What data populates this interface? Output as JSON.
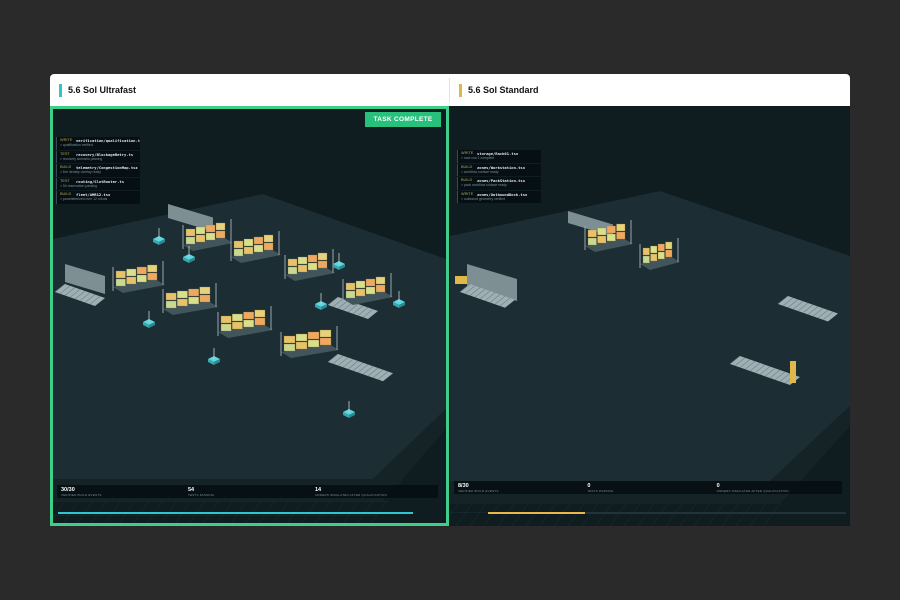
{
  "left": {
    "title": "5.6 Sol Ultrafast",
    "accent": "#3ed08a",
    "badge": "TASK COMPLETE",
    "log": [
      {
        "verb": "WRITE",
        "file": "verification/qualification.ts",
        "note": "> qualification verified"
      },
      {
        "verb": "TEST",
        "file": "recovery/BlockageRetry.ts",
        "note": "> recovery scenario passing"
      },
      {
        "verb": "BUILD",
        "file": "telemetry/CongestionMap.tsx",
        "note": "> live density overlay ready"
      },
      {
        "verb": "TEST",
        "file": "routing/SlotRouter.ts",
        "note": "> 54 reservation passing"
      },
      {
        "verb": "BUILD",
        "file": "fleet/AMR12.tsx",
        "note": "> parameterized over 12 robots"
      }
    ],
    "stats": [
      {
        "value": "30/30",
        "label": "VERIFIED BUILD EVENTS"
      },
      {
        "value": "54",
        "label": "TESTS PASSING"
      },
      {
        "value": "14",
        "label": "ORDERS SIMULATED AFTER QUALIFICATION"
      }
    ],
    "progress": 1.0,
    "progress_color": "#2ec6d0"
  },
  "right": {
    "title": "5.6 Sol Standard",
    "accent": "#e0b84a",
    "log": [
      {
        "verb": "WRITE",
        "file": "storage/Rack01.tsx",
        "note": "> rack row 1 complete"
      },
      {
        "verb": "BUILD",
        "file": "zones/Workstation.tsx",
        "note": "> workflow surface ready"
      },
      {
        "verb": "BUILD",
        "file": "zones/PackStation.tsx",
        "note": "> pack workflow surface ready"
      },
      {
        "verb": "WRITE",
        "file": "zones/OutboundDock.tsx",
        "note": "> outbound geometry verified"
      }
    ],
    "stats": [
      {
        "value": "8/30",
        "label": "VERIFIED BUILD EVENTS"
      },
      {
        "value": "0",
        "label": "TESTS PASSING"
      },
      {
        "value": "0",
        "label": "ORDERS SIMULATED AFTER QUALIFICATION"
      }
    ],
    "progress": 0.27,
    "progress_color": "#e8b84a"
  }
}
